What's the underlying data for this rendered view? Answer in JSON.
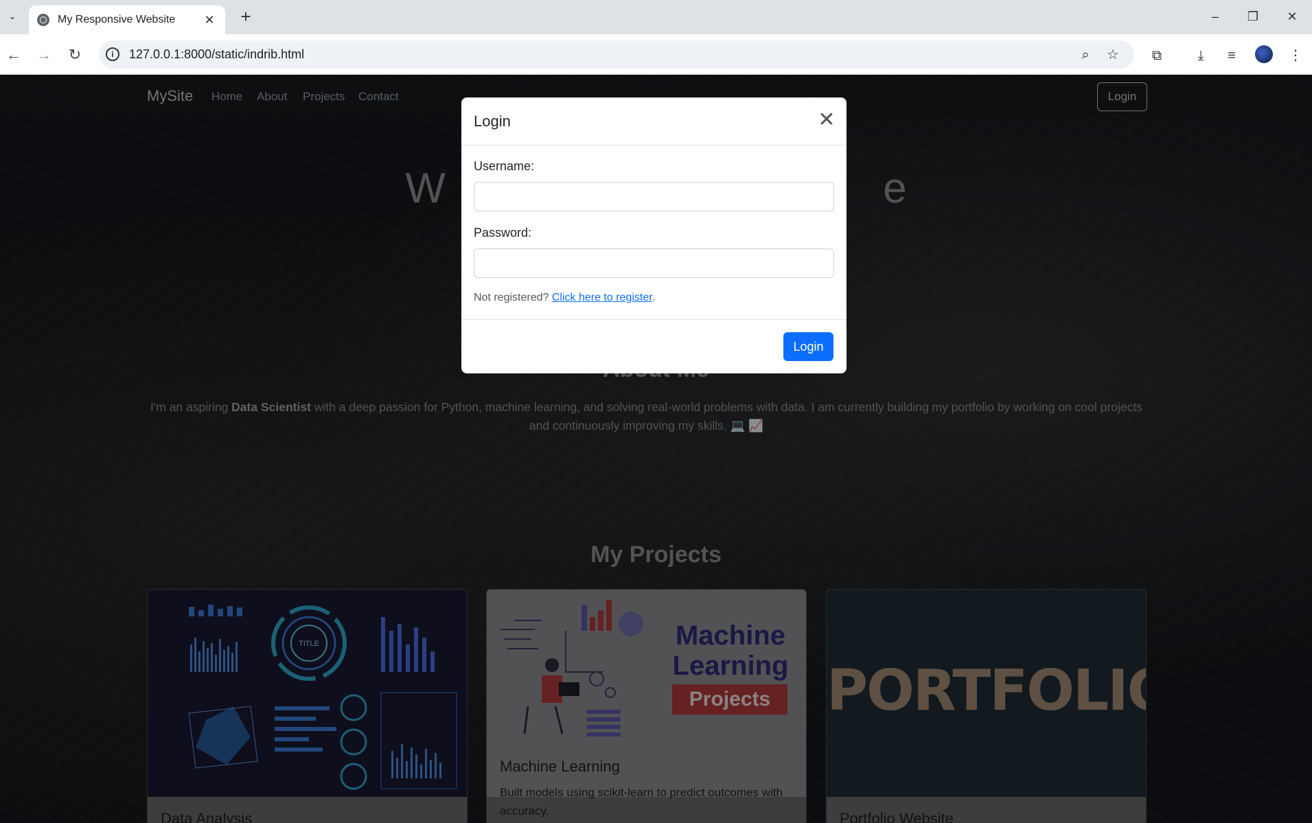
{
  "browser": {
    "tab_title": "My Responsive Website",
    "url": "127.0.0.1:8000/static/indrib.html"
  },
  "site": {
    "brand": "MySite",
    "nav": [
      "Home",
      "About",
      "Projects",
      "Contact"
    ],
    "login_label": "Login",
    "hero_title": "W                                     e",
    "about_heading": "About Me",
    "about_pre": "I'm an aspiring ",
    "about_bold": "Data Scientist",
    "about_post": " with a deep passion for Python, machine learning, and solving real-world problems with data. I am currently building my portfolio by working on cool projects and continuously improving my skills. 💻 📈",
    "projects_heading": "My Projects",
    "projects": [
      {
        "title": "Data Analysis",
        "text": ""
      },
      {
        "title": "Machine Learning",
        "text": "Built models using scikit-learn to predict outcomes with accuracy."
      },
      {
        "title": "Portfolio Website",
        "text": ""
      }
    ],
    "ml_image_title": "Machine Learning",
    "ml_image_badge": "Projects",
    "portfolio_image_word": "PORTFOLIO"
  },
  "modal": {
    "title": "Login",
    "username_label": "Username:",
    "password_label": "Password:",
    "username_value": "",
    "password_value": "",
    "register_prefix": "Not registered?",
    "register_link": "Click here to register",
    "register_suffix": ".",
    "submit_label": "Login"
  }
}
